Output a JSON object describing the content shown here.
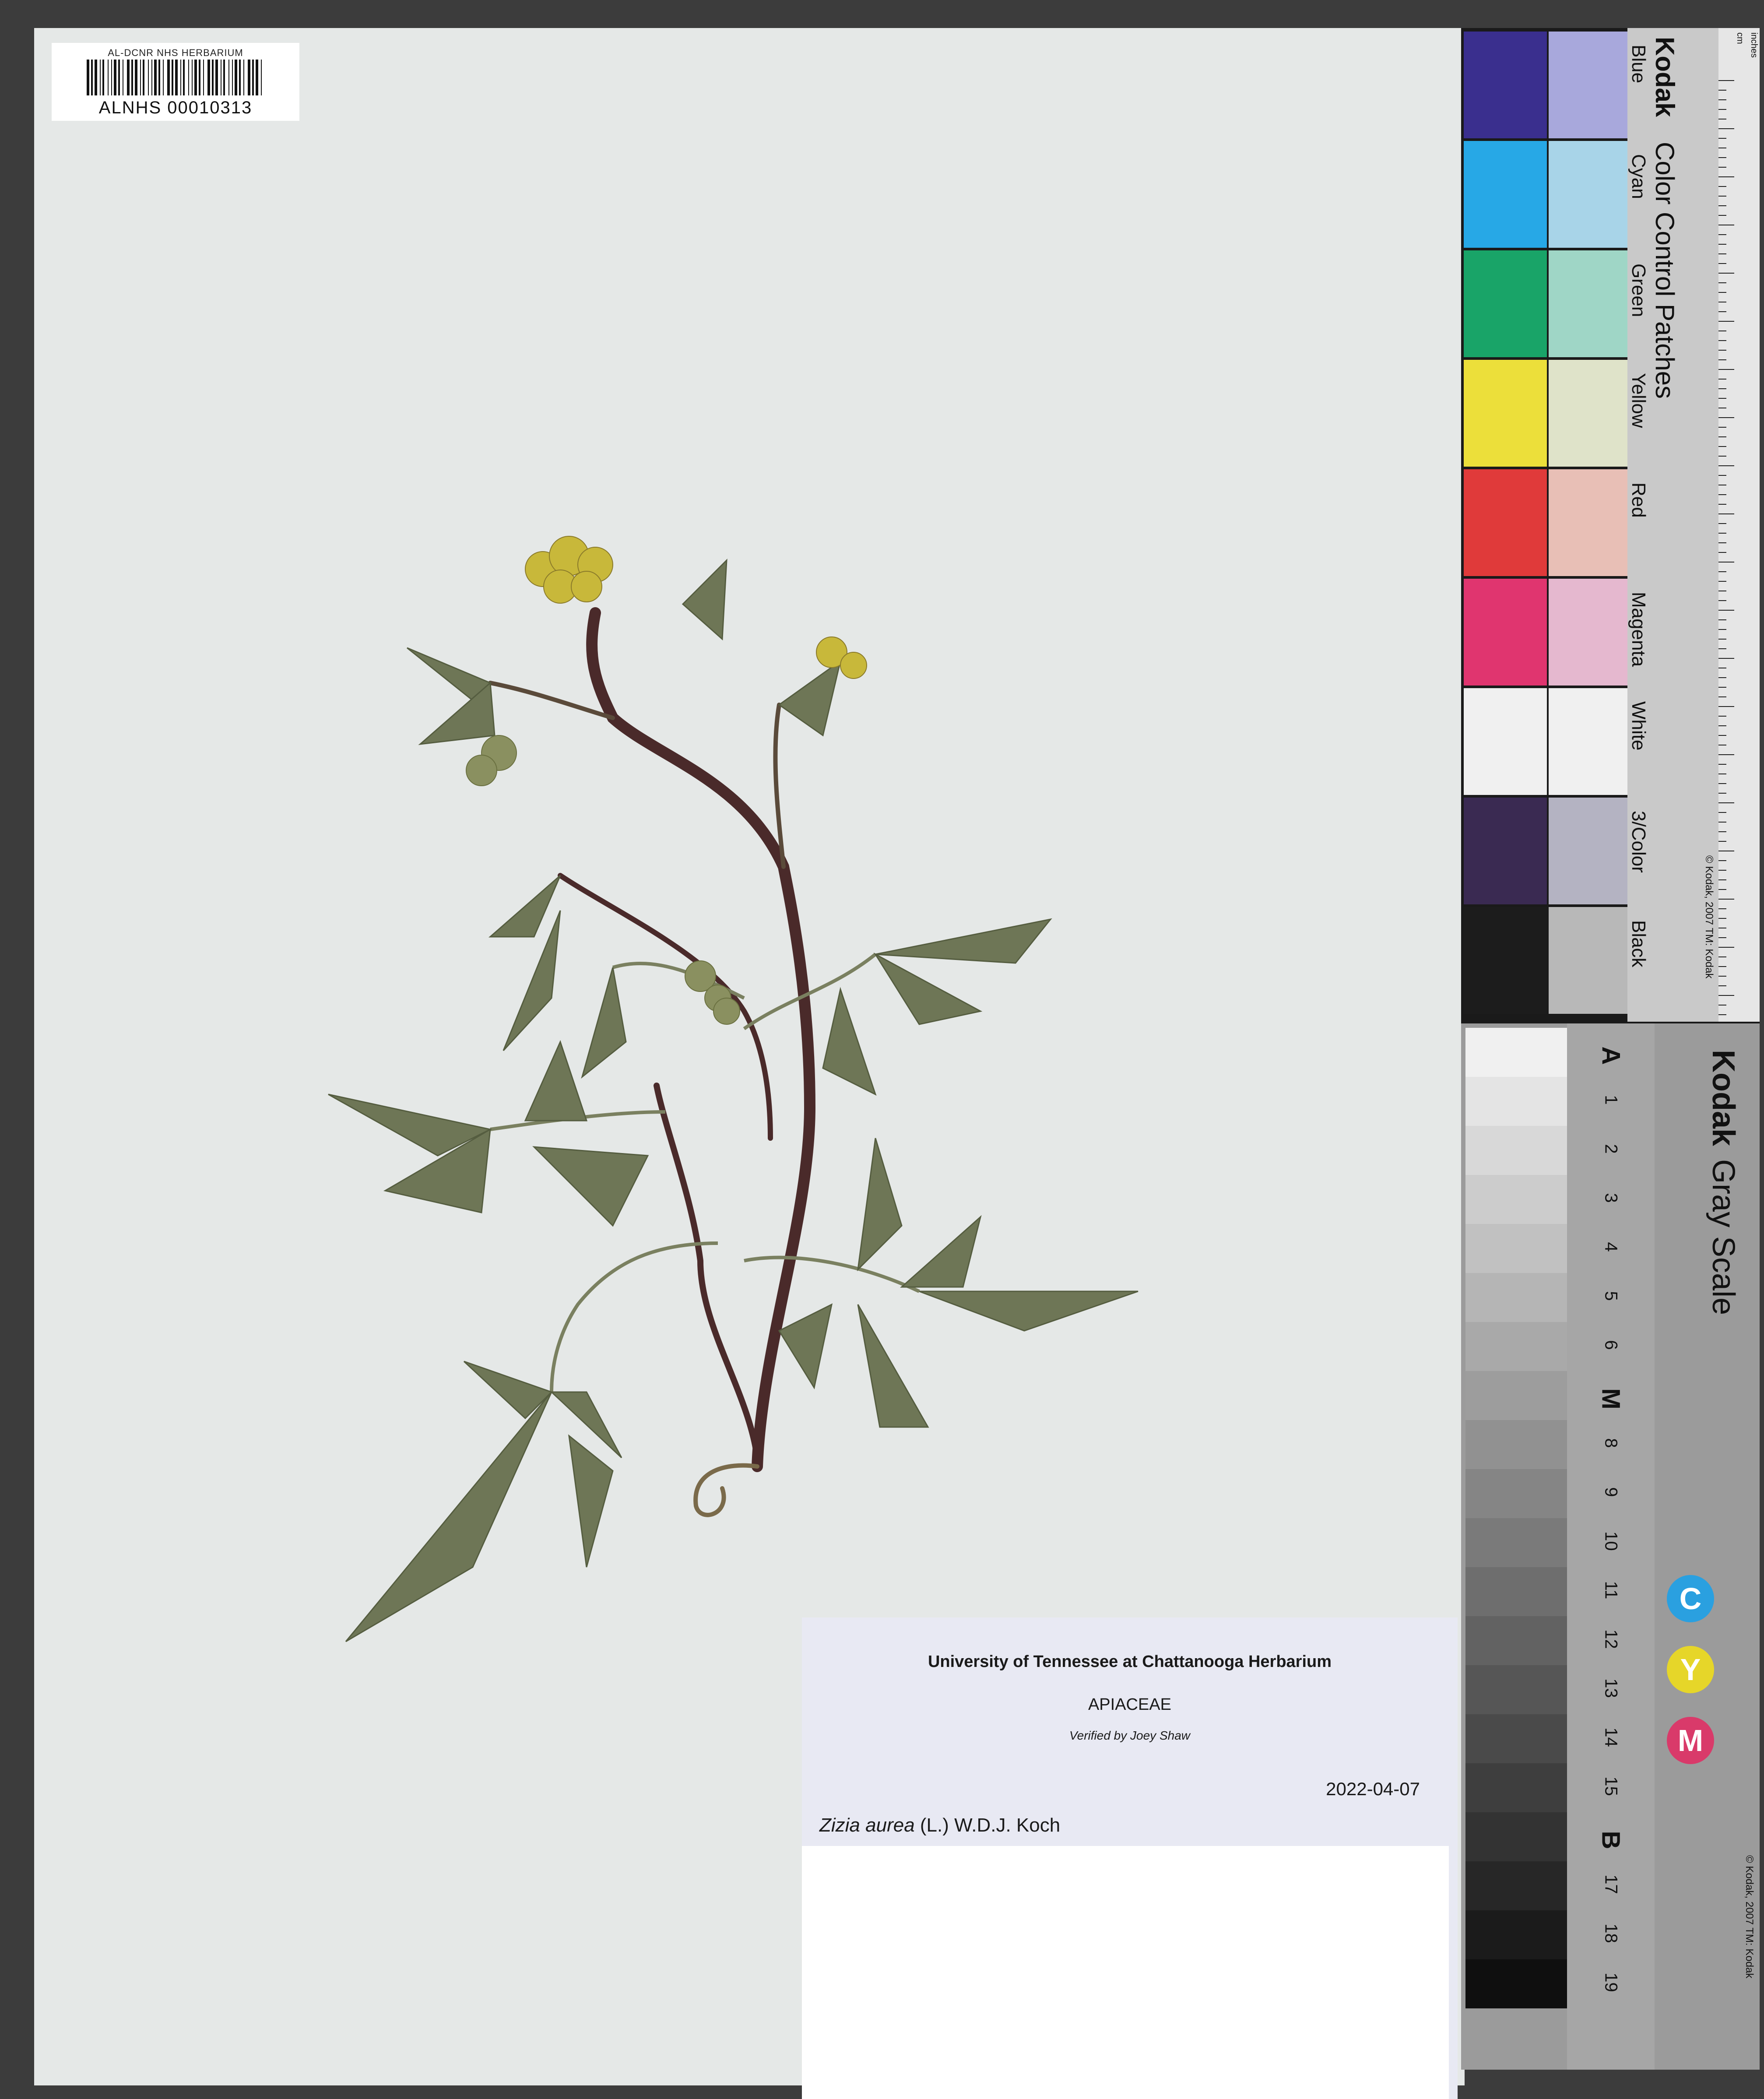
{
  "barcode": {
    "header": "AL-DCNR NHS HERBARIUM",
    "number": "ALNHS 00010313"
  },
  "label": {
    "institution": "University of Tennessee at Chattanooga Herbarium",
    "family": "APIACEAE",
    "verified": "Verified by Joey Shaw",
    "date": "2022-04-07",
    "genus_species": "Zizia aurea",
    "authority": "(L.) W.D.J. Koch"
  },
  "color_card": {
    "title_brand": "Kodak",
    "title_rest": "Color Control Patches",
    "copyright": "© Kodak, 2007 TM: Kodak",
    "patches": [
      {
        "name": "Blue",
        "dark": "#3a2f8e",
        "light": "#a8a8dc"
      },
      {
        "name": "Cyan",
        "dark": "#27a8e6",
        "light": "#a8d4e8"
      },
      {
        "name": "Green",
        "dark": "#19a468",
        "light": "#9fd6c6"
      },
      {
        "name": "Yellow",
        "dark": "#ecdf3a",
        "light": "#dfe3c9"
      },
      {
        "name": "Red",
        "dark": "#e03a3a",
        "light": "#e8bfb6"
      },
      {
        "name": "Magenta",
        "dark": "#e0356f",
        "light": "#e5b8cf"
      },
      {
        "name": "White",
        "dark": "#f0f0f0",
        "light": "#f0f0f0"
      },
      {
        "name": "3/Color",
        "dark": "#3a2a52",
        "light": "#b4b3c2"
      },
      {
        "name": "Black",
        "dark": "#1c1c1c",
        "light": "#b8b8b8"
      }
    ],
    "ruler_label": "inches",
    "ruler_cm_label": "cm"
  },
  "gray_card": {
    "title_brand": "Kodak",
    "title_rest": "Gray Scale",
    "copyright": "© Kodak, 2007 TM: Kodak",
    "labels": [
      "A",
      "1",
      "2",
      "3",
      "4",
      "5",
      "6",
      "M",
      "8",
      "9",
      "10",
      "11",
      "12",
      "13",
      "14",
      "15",
      "B",
      "17",
      "18",
      "19"
    ],
    "cym": [
      {
        "letter": "C",
        "color": "#2aa0e0"
      },
      {
        "letter": "Y",
        "color": "#e6d629"
      },
      {
        "letter": "M",
        "color": "#d93a6a"
      }
    ]
  }
}
